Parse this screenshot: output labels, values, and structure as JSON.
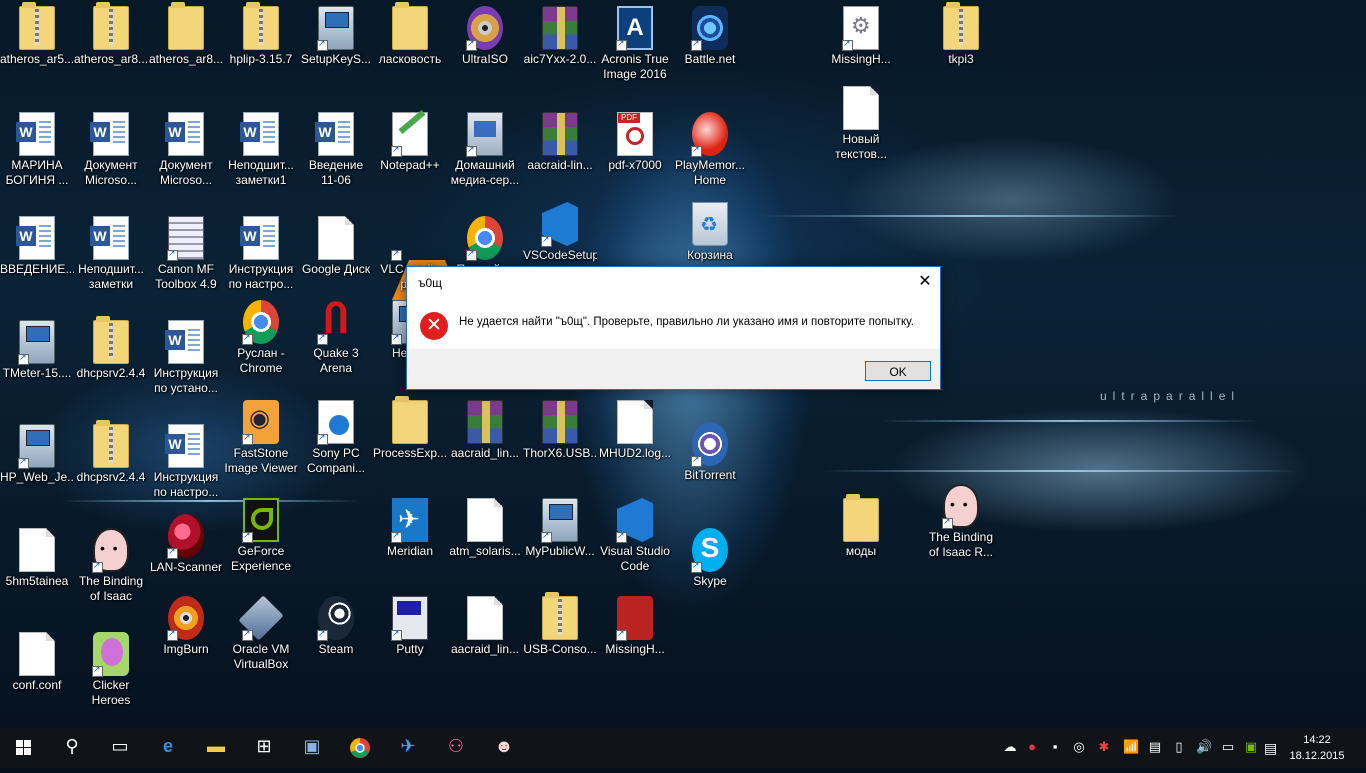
{
  "desktop": {
    "wallpaper_text": "ultraparallel",
    "icons": [
      {
        "label": "atheros_ar5...",
        "type": "zip"
      },
      {
        "label": "atheros_ar8...",
        "type": "zip"
      },
      {
        "label": "atheros_ar8...",
        "type": "folder"
      },
      {
        "label": "hplip-3.15.7",
        "type": "zip"
      },
      {
        "label": "SetupKeyS...",
        "type": "exe"
      },
      {
        "label": "ласковость",
        "type": "folder"
      },
      {
        "label": "UltraISO",
        "type": "disc"
      },
      {
        "label": "aic7Yxx-2.0...",
        "type": "rar"
      },
      {
        "label": "Acronis True Image 2016",
        "type": "acronis"
      },
      {
        "label": "Battle.net",
        "type": "bnet"
      },
      {
        "label": "MissingH...",
        "type": "settings"
      },
      {
        "label": "tkpi3",
        "type": "zip"
      },
      {
        "label": "МАРИНА БОГИНЯ ...",
        "type": "word"
      },
      {
        "label": "Документ Microso...",
        "type": "word"
      },
      {
        "label": "Документ Microso...",
        "type": "word"
      },
      {
        "label": "Неподшит... заметки1",
        "type": "word"
      },
      {
        "label": "Введение 11-06",
        "type": "word"
      },
      {
        "label": "Notepad++",
        "type": "notepad"
      },
      {
        "label": "Домашний медиа-сер...",
        "type": "media"
      },
      {
        "label": "aacraid-lin...",
        "type": "rar"
      },
      {
        "label": "pdf-x7000",
        "type": "pdf"
      },
      {
        "label": "PlayMemor... Home",
        "type": "playmem"
      },
      {
        "label": "Новый текстов...",
        "type": "doc"
      },
      {
        "label": "ВВЕДЕНИЕ...",
        "type": "word"
      },
      {
        "label": "Неподшит... заметки",
        "type": "word"
      },
      {
        "label": "Canon MF Toolbox 4.9",
        "type": "canon"
      },
      {
        "label": "Инструкция по настро...",
        "type": "word"
      },
      {
        "label": "Google Диск",
        "type": "doc"
      },
      {
        "label": "VLC media pl...",
        "type": "vlc"
      },
      {
        "label": "Первый ...",
        "type": "chrome"
      },
      {
        "label": "VSCodeSetup",
        "type": "vsblue"
      },
      {
        "label": "Корзина",
        "type": "recycle"
      },
      {
        "label": "TMeter-15....",
        "type": "exe"
      },
      {
        "label": "dhcpsrv2.4.4",
        "type": "zip"
      },
      {
        "label": "Инструкция по устано...",
        "type": "word"
      },
      {
        "label": "Руслан - Chrome",
        "type": "chrome"
      },
      {
        "label": "Quake 3 Arena",
        "type": "quake"
      },
      {
        "label": "Hero...",
        "type": "exe"
      },
      {
        "label": "HP_Web_Je...",
        "type": "exe"
      },
      {
        "label": "dhcpsrv2.4.4",
        "type": "zip"
      },
      {
        "label": "Инструкция по настро...",
        "type": "word"
      },
      {
        "label": "FastStone Image Viewer",
        "type": "faststone"
      },
      {
        "label": "Sony PC Compani...",
        "type": "sony"
      },
      {
        "label": "ProcessExp...",
        "type": "folder"
      },
      {
        "label": "aacraid_lin...",
        "type": "rar"
      },
      {
        "label": "ThorX6.USB...",
        "type": "rar"
      },
      {
        "label": "MHUD2.log...",
        "type": "doc"
      },
      {
        "label": "BitTorrent",
        "type": "bt"
      },
      {
        "label": "5hm5tainea",
        "type": "doc"
      },
      {
        "label": "The Binding of Isaac",
        "type": "isaac"
      },
      {
        "label": "LAN-Scanner",
        "type": "lan"
      },
      {
        "label": "GeForce Experience",
        "type": "nvidia"
      },
      {
        "label": "Meridian",
        "type": "meridian"
      },
      {
        "label": "atm_solaris...",
        "type": "doc"
      },
      {
        "label": "MyPublicW...",
        "type": "exe"
      },
      {
        "label": "Visual Studio Code",
        "type": "vsblue"
      },
      {
        "label": "Skype",
        "type": "skype"
      },
      {
        "label": "моды",
        "type": "folder"
      },
      {
        "label": "The Binding of Isaac R...",
        "type": "isaac"
      },
      {
        "label": "ImgBurn",
        "type": "imgburn"
      },
      {
        "label": "Oracle VM VirtualBox",
        "type": "vbox"
      },
      {
        "label": "Steam",
        "type": "steam"
      },
      {
        "label": "Putty",
        "type": "putty"
      },
      {
        "label": "aacraid_lin...",
        "type": "doc"
      },
      {
        "label": "USB-Conso...",
        "type": "zip"
      },
      {
        "label": "MissingH...",
        "type": "missing"
      },
      {
        "label": "conf.conf",
        "type": "doc"
      },
      {
        "label": "Clicker Heroes",
        "type": "clicker"
      }
    ]
  },
  "dialog": {
    "title": "ъ0щ",
    "close_glyph": "✕",
    "error_glyph": "✕",
    "message": "Не удается найти \"ъ0щ\". Проверьте, правильно ли указано имя и повторите попытку.",
    "ok_label": "OK"
  },
  "taskbar": {
    "start_icon": "windows-logo",
    "items": [
      "search",
      "task-view",
      "edge",
      "file-explorer",
      "store",
      "remote-desktop",
      "chrome",
      "meridian",
      "lan-scanner",
      "isaac"
    ],
    "tray": [
      "onedrive",
      "antivirus",
      "display",
      "steam",
      "tool",
      "network",
      "signal",
      "battery",
      "keyboard",
      "volume",
      "monitor",
      "nvidia"
    ],
    "time": "14:22",
    "date": "18.12.2015"
  }
}
